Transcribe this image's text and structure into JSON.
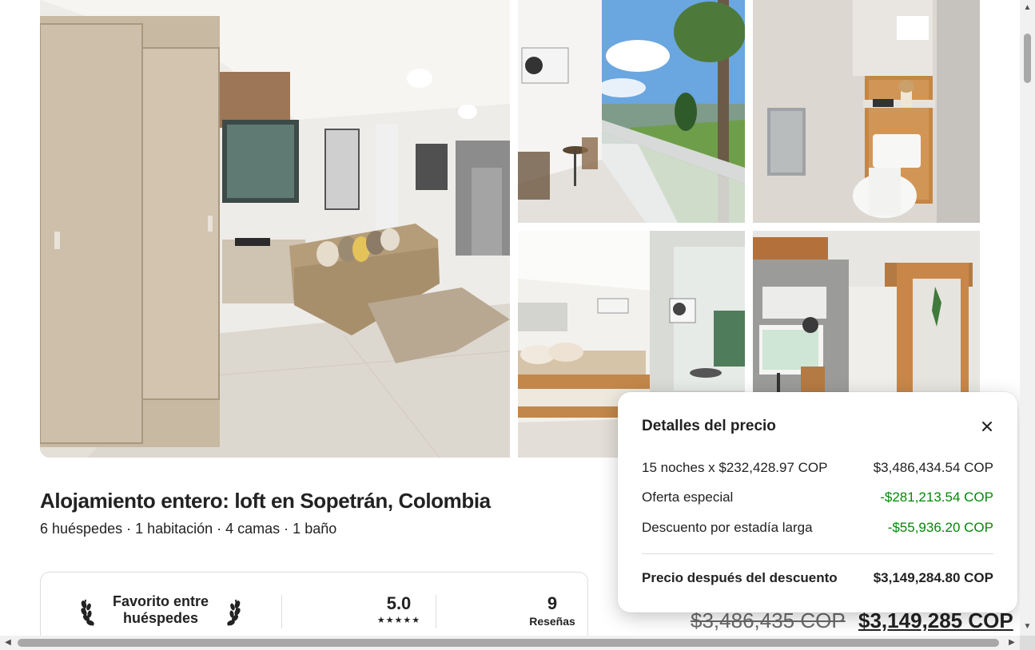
{
  "listing": {
    "title": "Alojamiento entero: loft en Sopetrán, Colombia",
    "details": "6 huéspedes · 1 habitación · 4 camas · 1 baño"
  },
  "guest_favorite": {
    "label": "Favorito entre huéspedes",
    "rating": "5.0",
    "stars": "★★★★★",
    "reviews_count": "9",
    "reviews_label": "Reseñas"
  },
  "price_details": {
    "title": "Detalles del precio",
    "close_icon": "close-icon",
    "rows": [
      {
        "label": "15 noches x $232,428.97 COP",
        "value": "$3,486,434.54 COP"
      },
      {
        "label": "Oferta especial",
        "value": "-$281,213.54 COP"
      },
      {
        "label": "Descuento por estadía larga",
        "value": "-$55,936.20 COP"
      }
    ],
    "total_label": "Precio después del descuento",
    "total_value": "$3,149,284.80 COP",
    "discount_color": "#008a05"
  },
  "booking": {
    "original_price": "$3,486,435 COP",
    "discounted_price": "$3,149,285 COP"
  },
  "scrollbars": {
    "up_arrow": "▲",
    "down_arrow": "▼",
    "left_arrow": "◀",
    "right_arrow": "▶"
  }
}
